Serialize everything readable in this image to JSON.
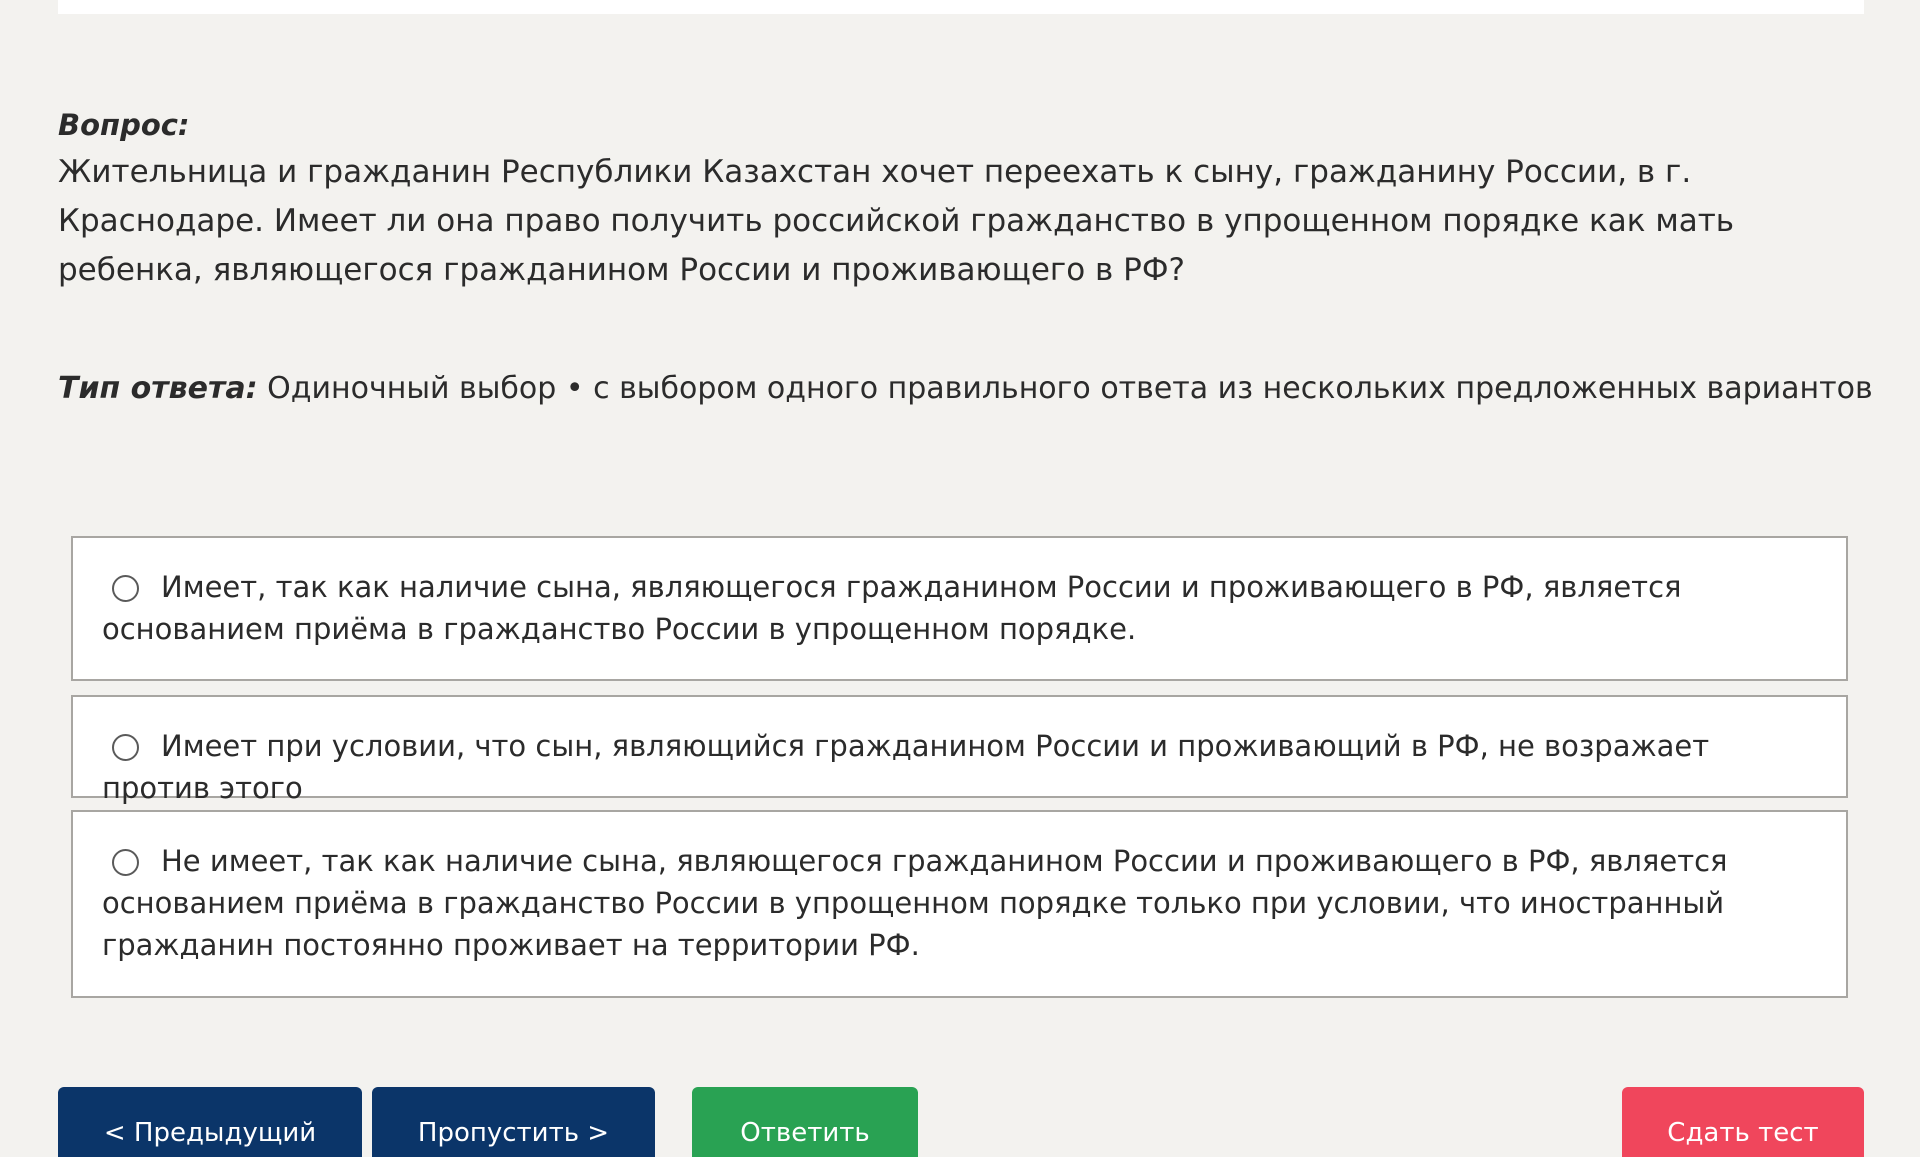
{
  "question": {
    "label": "Вопрос:",
    "text": "Жительница и гражданин Республики Казахстан хочет переехать к сыну, гражданину России, в г. Краснодаре. Имеет ли она право получить российской гражданство в упрощенном порядке как мать ребенка, являющегося гражданином России и проживающего в РФ?"
  },
  "answer_type": {
    "label": "Тип ответа:",
    "value": "Одиночный выбор • с выбором одного правильного ответа из нескольких предложенных вариантов"
  },
  "options": [
    {
      "text": "Имеет, так как наличие сына, являющегося гражданином России и проживающего в РФ, является основанием приёма в гражданство России в упрощенном порядке.",
      "selected": false
    },
    {
      "text": "Имеет при условии, что сын, являющийся гражданином России и проживающий в РФ, не возражает против этого",
      "selected": false
    },
    {
      "text": "Не имеет, так как наличие сына, являющегося гражданином России и проживающего в РФ, является основанием приёма в гражданство России в упрощенном порядке только при условии, что иностранный гражданин постоянно проживает на территории РФ.",
      "selected": false
    }
  ],
  "buttons": {
    "prev": "< Предыдущий",
    "skip": "Пропустить >",
    "answer": "Ответить",
    "finish": "Сдать тест"
  },
  "colors": {
    "background": "#f3f2ef",
    "nav_button": "#0b3569",
    "answer_button": "#29a253",
    "finish_button": "#f0465c"
  }
}
